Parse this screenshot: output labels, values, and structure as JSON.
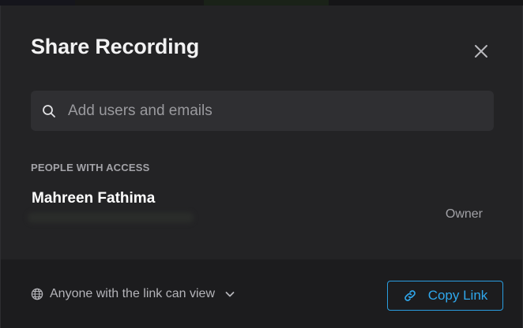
{
  "modal": {
    "title": "Share Recording"
  },
  "search": {
    "placeholder": "Add users and emails"
  },
  "access_section": {
    "label": "PEOPLE WITH ACCESS",
    "people": [
      {
        "name": "Mahreen Fathima",
        "role": "Owner"
      }
    ]
  },
  "footer": {
    "link_access": "Anyone with the link can view",
    "copy_button": "Copy Link"
  },
  "icons": {
    "close": "close-icon",
    "search": "search-icon",
    "globe": "globe-icon",
    "chevron": "chevron-down-icon",
    "link": "link-icon"
  },
  "colors": {
    "modal_bg": "#232325",
    "footer_bg": "#1c1c1e",
    "input_bg": "#2f2f32",
    "accent": "#2fa7ec"
  }
}
